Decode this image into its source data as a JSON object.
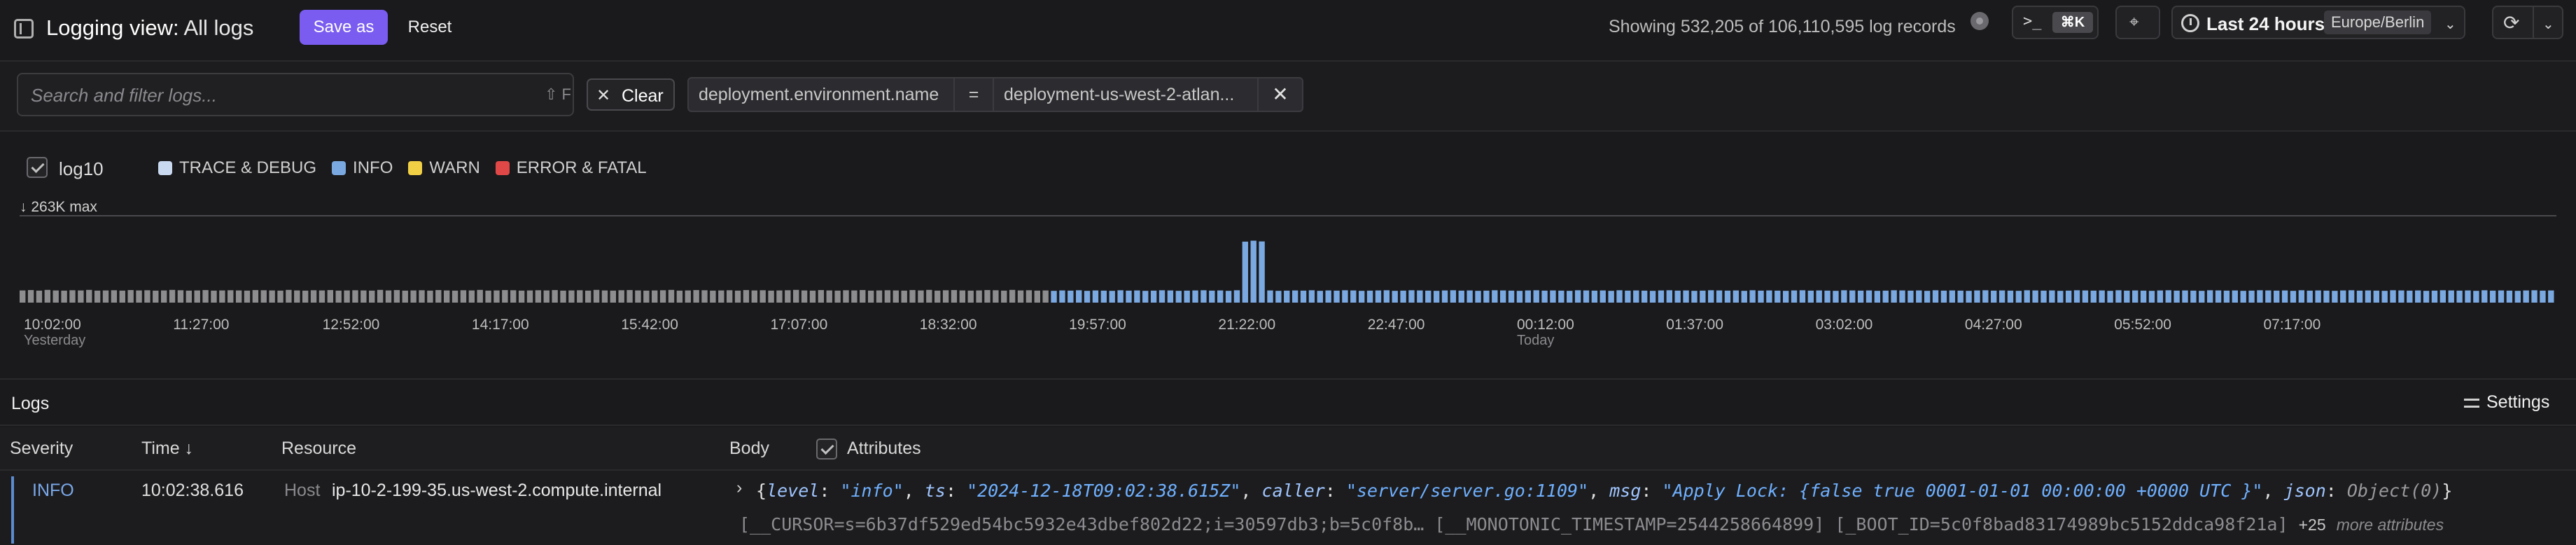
{
  "header": {
    "title": "Logging view:",
    "view_name": "All logs",
    "save_as": "Save as",
    "reset": "Reset",
    "showing": "Showing 532,205 of 106,110,595 log records",
    "command_prompt": ">_",
    "command_shortcut": "⌘K",
    "time_range": "Last 24 hours",
    "timezone": "Europe/Berlin"
  },
  "filter": {
    "search_placeholder": "Search and filter logs...",
    "search_shortcut": "⇧ F",
    "clear": "Clear",
    "chip_key": "deployment.environment.name",
    "chip_op": "=",
    "chip_value": "deployment-us-west-2-atlan..."
  },
  "histogram": {
    "log10_label": "log10",
    "legend": [
      {
        "label": "TRACE & DEBUG",
        "color": "#c9d9ef"
      },
      {
        "label": "INFO",
        "color": "#7aa8e0"
      },
      {
        "label": "WARN",
        "color": "#f2d046"
      },
      {
        "label": "ERROR & FATAL",
        "color": "#e04848"
      }
    ],
    "max_label": "↓ 263K max"
  },
  "chart_data": {
    "type": "bar",
    "title": "",
    "xlabel": "",
    "ylabel": "",
    "scale": "log10",
    "x_ticks": [
      {
        "label": "10:02:00",
        "sub": "Yesterday"
      },
      {
        "label": "11:27:00",
        "sub": ""
      },
      {
        "label": "12:52:00",
        "sub": ""
      },
      {
        "label": "14:17:00",
        "sub": ""
      },
      {
        "label": "15:42:00",
        "sub": ""
      },
      {
        "label": "17:07:00",
        "sub": ""
      },
      {
        "label": "18:32:00",
        "sub": ""
      },
      {
        "label": "19:57:00",
        "sub": ""
      },
      {
        "label": "21:22:00",
        "sub": ""
      },
      {
        "label": "22:47:00",
        "sub": ""
      },
      {
        "label": "00:12:00",
        "sub": "Today"
      },
      {
        "label": "01:37:00",
        "sub": ""
      },
      {
        "label": "03:02:00",
        "sub": ""
      },
      {
        "label": "04:27:00",
        "sub": ""
      },
      {
        "label": "05:52:00",
        "sub": ""
      },
      {
        "label": "07:17:00",
        "sub": ""
      }
    ],
    "max_value": 263000,
    "series": [
      {
        "name": "TRACE & DEBUG",
        "color": "#8d8d90",
        "values": [
          2100,
          2300,
          2000,
          2400,
          2100,
          2000,
          2200,
          2100,
          2400,
          2000,
          2100,
          2200,
          2000,
          2300,
          2100,
          2200,
          2000,
          2100,
          2400,
          2200,
          2000,
          2100,
          2300,
          2000,
          2100,
          2200,
          2100,
          2000,
          2300,
          2200,
          2100,
          2000,
          2400,
          2100,
          2000,
          2200,
          2100,
          2300,
          2000,
          2100,
          2200,
          2100,
          2000,
          2400,
          2100,
          2300,
          2000,
          2100,
          2200,
          2000,
          2300,
          2100,
          2000,
          2200,
          2100,
          2400,
          2000,
          2100,
          2300,
          2200,
          2000,
          2100,
          2200,
          2100,
          2300,
          2000,
          2100,
          2200,
          2000,
          2400,
          2100,
          2000,
          2200,
          2300,
          2100,
          2000,
          2100,
          2200,
          2400,
          2000,
          2100,
          2300,
          2200,
          2000,
          2100,
          2200,
          2000,
          2300,
          2100,
          2200,
          2000,
          2100,
          2200,
          2400,
          2100,
          2000,
          2300,
          2100,
          2000,
          2200,
          2100,
          2300,
          2000,
          2100,
          2200,
          2100,
          2000,
          2300,
          2100,
          2400,
          2000,
          2200,
          2300,
          2100,
          2000,
          2100,
          2300,
          2200,
          2000,
          2400,
          2100,
          2200,
          2000,
          2100
        ]
      },
      {
        "name": "INFO",
        "color": "#7aa8e0",
        "values": [
          1900,
          2100,
          2000,
          2200,
          1900,
          2100,
          2000,
          1900,
          2200,
          2000,
          2100,
          1900,
          2000,
          2200,
          2100,
          1900,
          2000,
          2100,
          2200,
          2000,
          2100,
          1900,
          2200,
          6200,
          7100,
          6400,
          2100,
          1900,
          2000,
          2100,
          2000,
          2200,
          1900,
          2100,
          2000,
          2200,
          2100,
          1900,
          2000,
          2100,
          2200,
          1900,
          2000,
          2200,
          2100,
          2000,
          1900,
          2100,
          2200,
          2000,
          2100,
          1900,
          2000,
          2200,
          2100,
          2000,
          1900,
          2100,
          2200,
          2000,
          2100,
          2000,
          1900,
          2200,
          2100,
          2000,
          2100,
          1900,
          2200,
          2000,
          2100,
          2000,
          1900,
          2100,
          2200,
          2000,
          2100,
          1900,
          2000,
          2200,
          2100,
          2000,
          2100,
          1900,
          2200,
          2000,
          2100,
          2000,
          1900,
          2100,
          2200,
          2000,
          2100,
          2000,
          1900,
          2200,
          2100,
          2000,
          2100,
          1900,
          2000,
          2200,
          2100,
          2000,
          2100,
          1900,
          2200,
          2000,
          2100,
          2000,
          1900,
          2100,
          2200,
          2000,
          2100,
          2000,
          1900,
          2200,
          2100,
          2000,
          2100,
          1900,
          2000,
          2200,
          2100,
          2000,
          2100,
          1900,
          2200,
          2000,
          2100,
          2000,
          1900,
          2100,
          2200,
          2000,
          2100,
          2000,
          1900,
          2200,
          2100,
          2000,
          2100,
          1900,
          2000,
          2200,
          2100,
          2000,
          2100,
          1900,
          2200,
          2000,
          2100,
          2000,
          1900,
          2100,
          2200,
          2000,
          2100,
          2000,
          1900,
          2200,
          2100,
          2000,
          2100,
          1900,
          2000,
          2200,
          2100,
          2000,
          2100,
          1900,
          2200,
          2000,
          2100,
          2000,
          1900,
          2100,
          2200,
          2000,
          2100
        ]
      }
    ]
  },
  "logs": {
    "title": "Logs",
    "settings": "Settings",
    "columns": {
      "severity": "Severity",
      "time": "Time ↓",
      "resource": "Resource",
      "body": "Body",
      "attributes": "Attributes"
    },
    "rows": [
      {
        "severity": "INFO",
        "time": "10:02:38.616",
        "host_key": "Host",
        "host_value": "ip-10-2-199-35.us-west-2.compute.internal",
        "body": {
          "level": "\"info\"",
          "ts": "\"2024-12-18T09:02:38.615Z\"",
          "caller": "\"server/server.go:1109\"",
          "msg": "\"Apply Lock: {false true 0001-01-01 00:00:00 +0000 UTC }\"",
          "json": "Object(0)"
        },
        "attributes": "[__CURSOR=s=6b37df529ed54bc5932e43dbef802d22;i=30597db3;b=5c0f8b…  [__MONOTONIC_TIMESTAMP=2544258664899] [_BOOT_ID=5c0f8bad83174989bc5152ddca98f21a]",
        "more_count": "+25",
        "more_text": "more attributes"
      }
    ]
  }
}
